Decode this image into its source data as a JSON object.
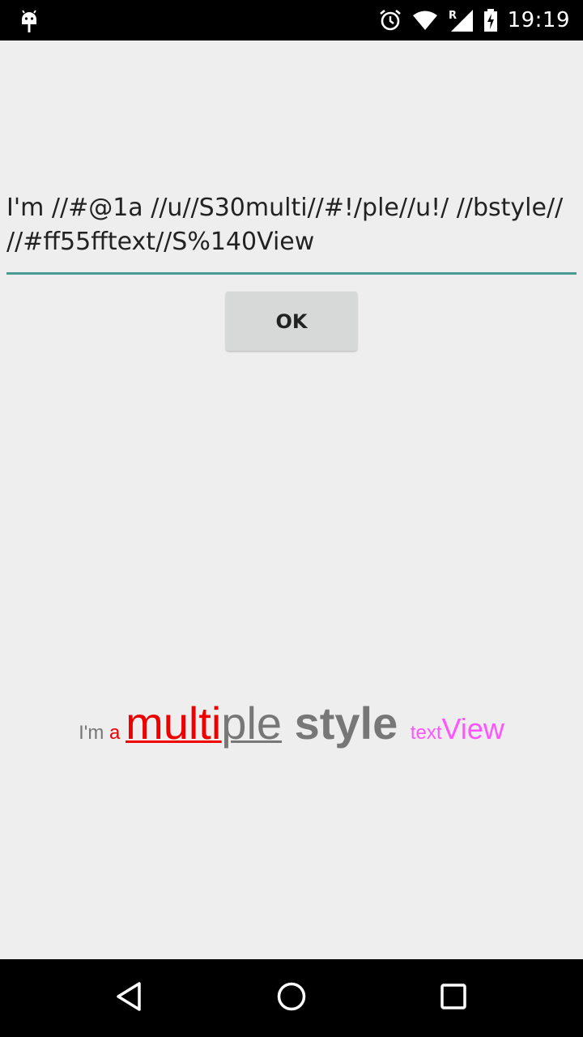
{
  "status_bar": {
    "time": "19:19",
    "icons": [
      "android-debug-icon",
      "alarm-icon",
      "wifi-icon",
      "signal-roaming-icon",
      "battery-charging-icon"
    ],
    "roaming_label": "R"
  },
  "input": {
    "value": "I'm //#@1a //u//S30multi//#!/ple//u!/ //bstyle// //#ff55fftext//S%140View",
    "underline_color": "#4b9a95"
  },
  "ok_button": {
    "label": "OK"
  },
  "styled_text": {
    "segments": [
      {
        "text": "I'm ",
        "color": "#777777"
      },
      {
        "text": "a ",
        "color": "#ee0000"
      },
      {
        "text": "multi",
        "color": "#ee0000"
      },
      {
        "text": "ple",
        "color": "#777777"
      },
      {
        "text": " style ",
        "color": "#777777"
      },
      {
        "text": "text",
        "color": "#ff55ff"
      },
      {
        "text": "View",
        "color": "#ff55ff"
      }
    ]
  },
  "nav_bar": {
    "buttons": [
      "back-icon",
      "home-icon",
      "recent-apps-icon"
    ]
  }
}
